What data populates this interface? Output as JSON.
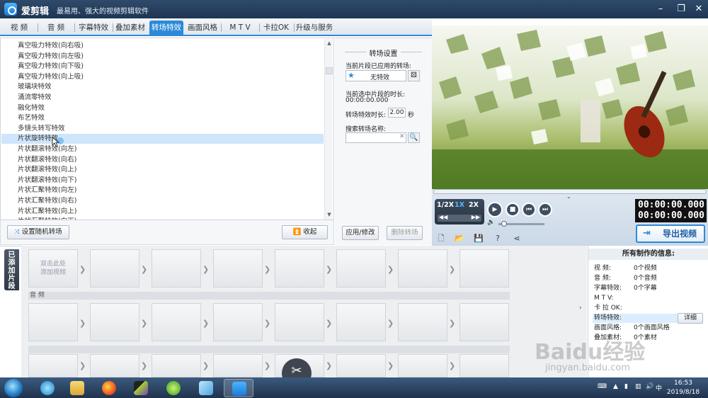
{
  "window": {
    "app_name": "爱剪辑",
    "slogan": "最易用、强大的视频剪辑软件"
  },
  "tabs": [
    {
      "label": "视  频"
    },
    {
      "label": "音  频"
    },
    {
      "label": "字幕特效"
    },
    {
      "label": "叠加素材"
    },
    {
      "label": "转场特效",
      "active": true
    },
    {
      "label": "画面风格"
    },
    {
      "label": "M T V"
    },
    {
      "label": "卡拉OK"
    },
    {
      "label": "升级与服务"
    }
  ],
  "effects_list": {
    "items": [
      "真空吸力特效(向右吸)",
      "真空吸力特效(向左吸)",
      "真空吸力特效(向下吸)",
      "真空吸力特效(向上吸)",
      "玻璃块特效",
      "涌流零特效",
      "融化特效",
      "布艺特效",
      "多镜头转写特效",
      "片状旋转特效",
      "片状翻滚特效(向左)",
      "片状翻滚特效(向右)",
      "片状翻滚特效(向上)",
      "片状翻滚特效(向下)",
      "片状汇聚特效(向左)",
      "片状汇聚特效(向右)",
      "片状汇聚特效(向上)",
      "片状汇聚特效(向下)"
    ],
    "selected_index": 9,
    "random_button": "设置随机转场",
    "collapse_button": "收起"
  },
  "transition_settings": {
    "title": "转场设置",
    "applied_label": "当前片段已应用的转场:",
    "applied_value": "无特效",
    "duration_info_label": "当前选中片段的时长:",
    "duration_info_value": "00:00:00.000",
    "effect_duration_label": "转场特效时长:",
    "effect_duration_value": "2.00",
    "effect_duration_unit": "秒",
    "search_label": "搜索转场名称:",
    "search_value": "",
    "apply_button": "应用/修改",
    "delete_button": "删除转场"
  },
  "player": {
    "speeds": [
      "1/2X",
      "1X",
      "2X"
    ],
    "active_speed": "1X",
    "time_current": "00:00:00.000",
    "time_total": "00:00:00.000",
    "export_button": "导出视频"
  },
  "workspace": {
    "added_clips_tab": "已添加片段",
    "first_slot_hint": "双击此处添加视频",
    "audio_section": "音  频"
  },
  "info_panel": {
    "title": "所有制作的信息:",
    "rows": [
      {
        "label": "视    频:",
        "value": "0个视频"
      },
      {
        "label": "音    频:",
        "value": "0个音频"
      },
      {
        "label": "字幕特效:",
        "value": "0个字幕"
      },
      {
        "label": "M  T  V:",
        "value": ""
      },
      {
        "label": "卡  拉 OK:",
        "value": ""
      },
      {
        "label": "转场特效:",
        "value": ""
      },
      {
        "label": "画面风格:",
        "value": "0个画面风格"
      },
      {
        "label": "叠加素材:",
        "value": "0个素材"
      }
    ],
    "detail_button": "详细"
  },
  "taskbar": {
    "time": "16:53",
    "date": "2019/8/18"
  },
  "watermark": {
    "line1": "Baidu经验",
    "line2": "jingyan.baidu.com"
  }
}
